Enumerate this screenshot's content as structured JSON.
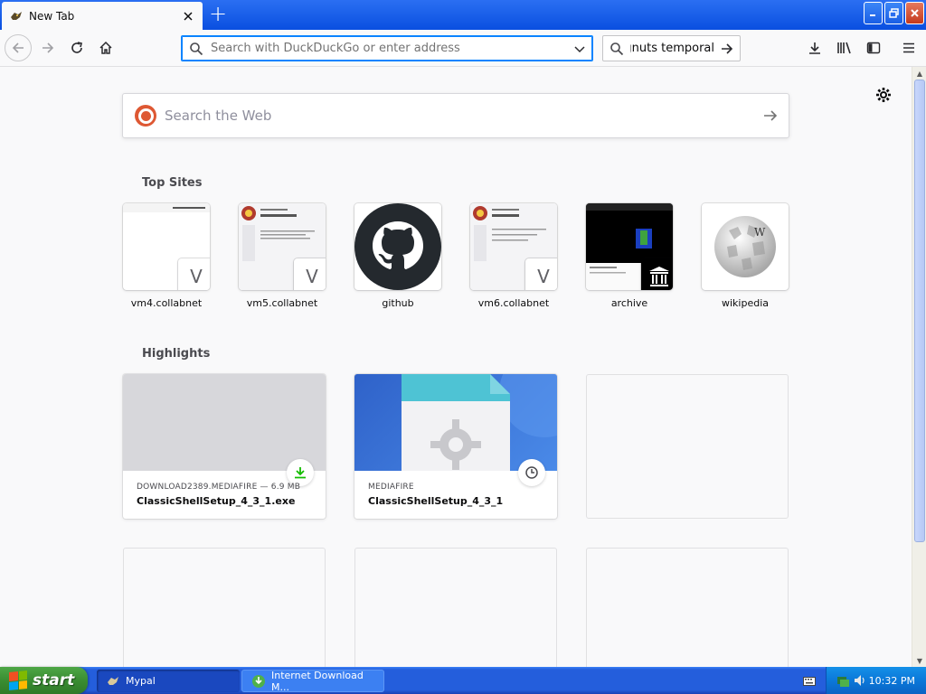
{
  "browser": {
    "tab": {
      "title": "New Tab"
    },
    "url_placeholder": "Search with DuckDuckGo or enter address",
    "search_value": "Firefox gnuts temporal"
  },
  "newtab": {
    "web_search_placeholder": "Search the Web",
    "top_sites_title": "Top Sites",
    "top_sites": [
      {
        "label": "vm4.collabnet",
        "badge": "V"
      },
      {
        "label": "vm5.collabnet",
        "badge": "V"
      },
      {
        "label": "github"
      },
      {
        "label": "vm6.collabnet",
        "badge": "V"
      },
      {
        "label": "archive"
      },
      {
        "label": "wikipedia",
        "badge": "W"
      }
    ],
    "highlights_title": "Highlights",
    "highlights": [
      {
        "host": "DOWNLOAD2389.MEDIAFIRE — 6.9 MB",
        "title": "ClassicShellSetup_4_3_1.exe"
      },
      {
        "host": "MEDIAFIRE",
        "title": "ClassicShellSetup_4_3_1"
      }
    ]
  },
  "taskbar": {
    "start_label": "start",
    "items": [
      {
        "label": "Mypal"
      },
      {
        "label": "Internet Download M..."
      }
    ],
    "clock": "10:32 PM"
  },
  "colors": {
    "accent": "#0a84ff",
    "xp_blue": "#245edc",
    "start_green": "#3a8d32"
  }
}
